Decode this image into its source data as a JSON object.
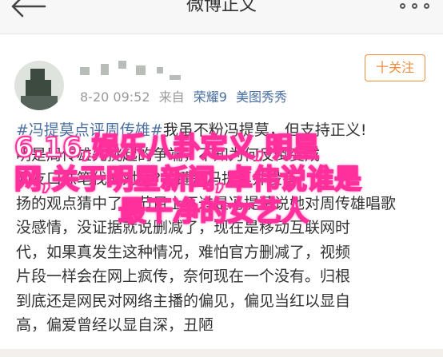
{
  "header": {
    "title": "微博正文",
    "back_icon": "back-arrow-icon",
    "more_icon": "more-dots-icon"
  },
  "author": {
    "avatar_icon": "avatar",
    "time": "8-20 09:52",
    "source_prefix": "来自",
    "device": "荣耀9",
    "source_suffix": "美图秀秀",
    "follow_label": "十关注",
    "accent_color": "#f08c3a"
  },
  "post": {
    "hashtag": "#冯提莫点评周传雄#",
    "lines": [
      "我虽不粉冯提莫，但支持正义!",
      "明是周传雄先挑起的争端，不知为何反倒变成",
      "网友口诛笔伐的对象?关键是冯提莫并没有",
      "扬的观点猜中了，节目上不过是冯提莫说她对周传雄唱歌",
      "没感情，没证据就说删减了，现在是移动互联网时",
      "代，如果真发生这种情况，难怕官方删减了，视频",
      "片段一样会在网上疯传，奈何现在一个没有。归根",
      "到底还是网民对网络主播的偏见，偏见当红以显自",
      "高，偏爱曾经以显自深，丑陋"
    ],
    "link_color": "#4a6fa0"
  },
  "overlay": {
    "lines": [
      "6.16,娱乐八卦定义,明星",
      "网,关于明星新闻,卓伟说谁是",
      "最干净的女艺人"
    ],
    "stroke_color": "#ff2f9c"
  }
}
